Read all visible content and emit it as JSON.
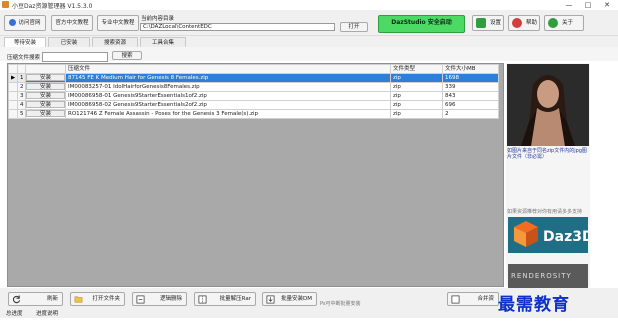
{
  "window": {
    "title": "小豆Daz资源管理器 V1.5.3.0",
    "controls": [
      "—",
      "□",
      "✕"
    ]
  },
  "toolbar": {
    "visit_site": "访问官网",
    "official_tutorial": "官方中文教程",
    "pro_tutorial": "专业中文教程",
    "content_dir_label": "当前内容目录",
    "content_dir_value": "C:\\DAZLocal\\ContentEDC",
    "open_button": "打开",
    "daz_button": "DazStudio 安全启动",
    "settings": "设置",
    "help": "帮助",
    "about": "关于"
  },
  "tabs": [
    "等待安装",
    "已安装",
    "搜索资源",
    "工具合集"
  ],
  "search": {
    "label": "压缩文件搜索",
    "value": "",
    "button": "搜索"
  },
  "grid": {
    "columns": [
      "",
      "",
      "压缩文件",
      "文件类型",
      "文件大小MB"
    ],
    "rows": [
      {
        "marker": "▶",
        "num": "1",
        "action": "安装",
        "file": "87145 FE K Medium Hair for Genesis 8 Females.zip",
        "type": "zip",
        "size": "1698",
        "selected": true
      },
      {
        "marker": "",
        "num": "2",
        "action": "安装",
        "file": "IM00083257-01 IdolHairforGenesis8Females.zip",
        "type": "zip",
        "size": "339",
        "selected": false
      },
      {
        "marker": "",
        "num": "3",
        "action": "安装",
        "file": "IM00086958-01 Genesis9StarterEssentials1of2.zip",
        "type": "zip",
        "size": "843",
        "selected": false
      },
      {
        "marker": "",
        "num": "4",
        "action": "安装",
        "file": "IM00086958-02 Genesis9StarterEssentials2of2.zip",
        "type": "zip",
        "size": "696",
        "selected": false
      },
      {
        "marker": "",
        "num": "5",
        "action": "安装",
        "file": "RO121746 Z Female Assassin - Poses for the Genesis 3 Female(s).zip",
        "type": "zip",
        "size": "2",
        "selected": false
      }
    ]
  },
  "right_panel": {
    "preview_caption": "如图片来自于同名zip文件内的jpg图片文件（非必需）",
    "ad_note": "如果资源推荐对你有用请多多支持",
    "daz_logo": "Daz3D",
    "render_logo": "RENDEROSITY"
  },
  "bottom": {
    "refresh": "刷新",
    "open_folder": "打开文件夹",
    "logical_delete": "逻辑删除",
    "batch_unzip": "批量解压Rar",
    "batch_install": "批量安装DM",
    "hint": "Ps可中断批量安装",
    "merge": "合并资"
  },
  "status": {
    "total": "总进度",
    "progress": "进度说明"
  },
  "watermark": "最需教育",
  "colors": {
    "daz_button": "#4cd964",
    "selection": "#2f7fd8",
    "settings_icon": "#2e9e3f",
    "help_icon": "#d43d3d",
    "about_icon": "#2e9e3f"
  }
}
